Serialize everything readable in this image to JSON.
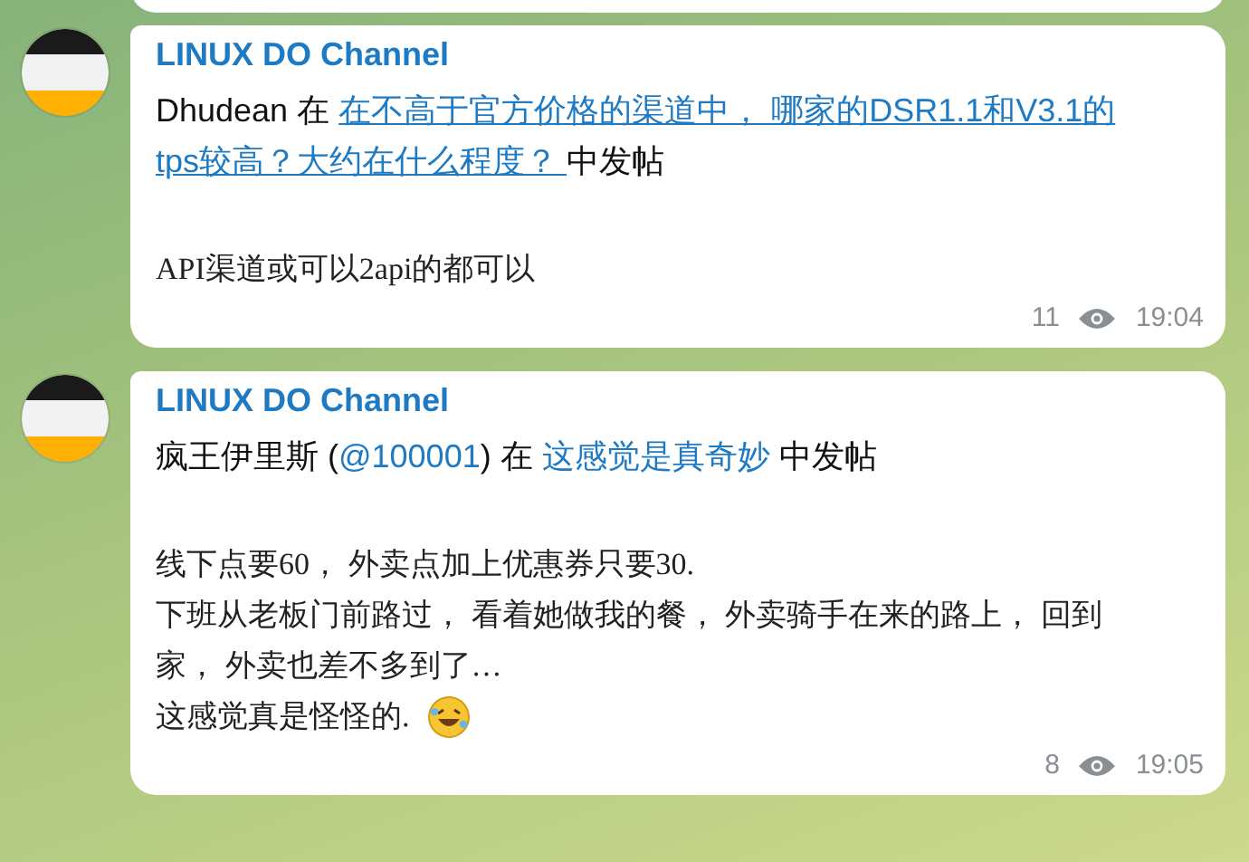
{
  "messages": [
    {
      "channel": "LINUX DO Channel",
      "header": [
        {
          "kind": "text",
          "text": "Dhudean 在 "
        },
        {
          "kind": "underlined_link",
          "text": "在不高于官方价格的渠道中， 哪家的DSR1.1和V3.1的"
        },
        {
          "kind": "underlined_link",
          "text": "tps较高？大约在什么程度？ "
        },
        {
          "kind": "text",
          "text": " 中发帖"
        }
      ],
      "body": [
        "API渠道或可以2api的都可以"
      ],
      "emoji": false,
      "views": "11",
      "time": "19:04"
    },
    {
      "channel": "LINUX DO Channel",
      "header": [
        {
          "kind": "text",
          "text": "疯王伊里斯 ("
        },
        {
          "kind": "mention",
          "text": "@100001"
        },
        {
          "kind": "text",
          "text": ") 在 "
        },
        {
          "kind": "link",
          "text": "这感觉是真奇妙"
        },
        {
          "kind": "text",
          "text": " 中发帖"
        }
      ],
      "body": [
        "线下点要60， 外卖点加上优惠券只要30.",
        "下班从老板门前路过， 看着她做我的餐， 外卖骑手在来的路上， 回到家， 外卖也差不多到了…",
        "这感觉真是怪怪的."
      ],
      "emoji": true,
      "views": "8",
      "time": "19:05"
    }
  ]
}
